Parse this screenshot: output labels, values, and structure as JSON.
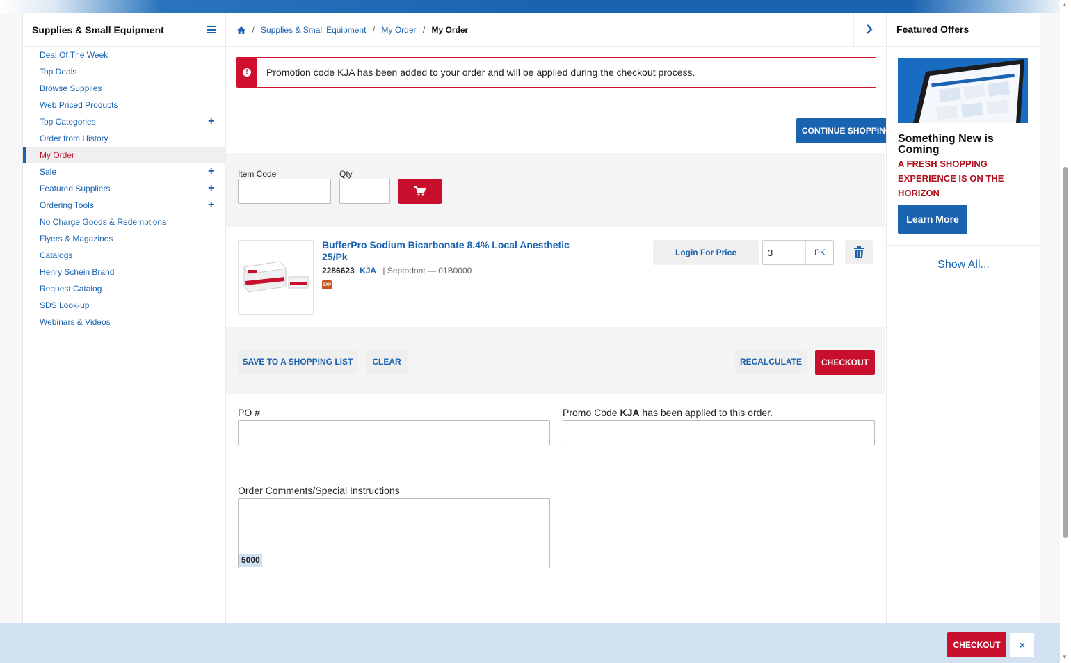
{
  "sidebar": {
    "title": "Supplies & Small Equipment",
    "items": [
      {
        "label": "Deal Of The Week",
        "expandable": false,
        "active": false
      },
      {
        "label": "Top Deals",
        "expandable": false,
        "active": false
      },
      {
        "label": "Browse Supplies",
        "expandable": false,
        "active": false
      },
      {
        "label": "Web Priced Products",
        "expandable": false,
        "active": false
      },
      {
        "label": "Top Categories",
        "expandable": true,
        "active": false
      },
      {
        "label": "Order from History",
        "expandable": false,
        "active": false
      },
      {
        "label": "My Order",
        "expandable": false,
        "active": true
      },
      {
        "label": "Sale",
        "expandable": true,
        "active": false
      },
      {
        "label": "Featured Suppliers",
        "expandable": true,
        "active": false
      },
      {
        "label": "Ordering Tools",
        "expandable": true,
        "active": false
      },
      {
        "label": "No Charge Goods & Redemptions",
        "expandable": false,
        "active": false
      },
      {
        "label": "Flyers & Magazines",
        "expandable": false,
        "active": false
      },
      {
        "label": "Catalogs",
        "expandable": false,
        "active": false
      },
      {
        "label": "Henry Schein Brand",
        "expandable": false,
        "active": false
      },
      {
        "label": "Request Catalog",
        "expandable": false,
        "active": false
      },
      {
        "label": "SDS Look-up",
        "expandable": false,
        "active": false
      },
      {
        "label": "Webinars & Videos",
        "expandable": false,
        "active": false
      }
    ]
  },
  "breadcrumb": {
    "items": [
      "Supplies & Small Equipment",
      "My Order"
    ],
    "current": "My Order",
    "separator": "/"
  },
  "alert": {
    "text": "Promotion code KJA has been added to your order and will be applied during the checkout process.",
    "icon": "exclamation-icon"
  },
  "buttons": {
    "continue_shopping": "CONTINUE SHOPPING",
    "save_to_list": "SAVE TO A SHOPPING LIST",
    "clear": "CLEAR",
    "recalculate": "RECALCULATE",
    "checkout": "CHECKOUT",
    "login_for_price": "Login For Price"
  },
  "quick_add": {
    "item_code_label": "Item Code",
    "qty_label": "Qty",
    "item_code_value": "",
    "qty_value": ""
  },
  "cart_item": {
    "name": "BufferPro Sodium Bicarbonate 8.4% Local Anesthetic 25/Pk",
    "item_code": "2286623",
    "promo_code": "KJA",
    "manufacturer": "| Septodont — 01B0000",
    "quantity": "3",
    "unit": "PK",
    "exp_badge": "EXP"
  },
  "form": {
    "po_label": "PO #",
    "po_value": "",
    "promo_prefix": "Promo Code ",
    "promo_code": "KJA",
    "promo_suffix": " has been applied to this order.",
    "promo_value": "",
    "comments_label": "Order Comments/Special Instructions",
    "comments_value": "",
    "char_remaining": "5000"
  },
  "featured": {
    "title": "Featured Offers",
    "heading": "Something New is Coming",
    "subheading": "A FRESH SHOPPING EXPERIENCE IS ON THE HORIZON",
    "cta": "Learn More",
    "show_all": "Show All..."
  },
  "bottom_bar": {
    "checkout": "CHECKOUT",
    "close": "×"
  },
  "colors": {
    "brand_blue": "#1a63b0",
    "brand_red": "#c8102e",
    "bottom_bar_bg": "#d3e2f3"
  }
}
